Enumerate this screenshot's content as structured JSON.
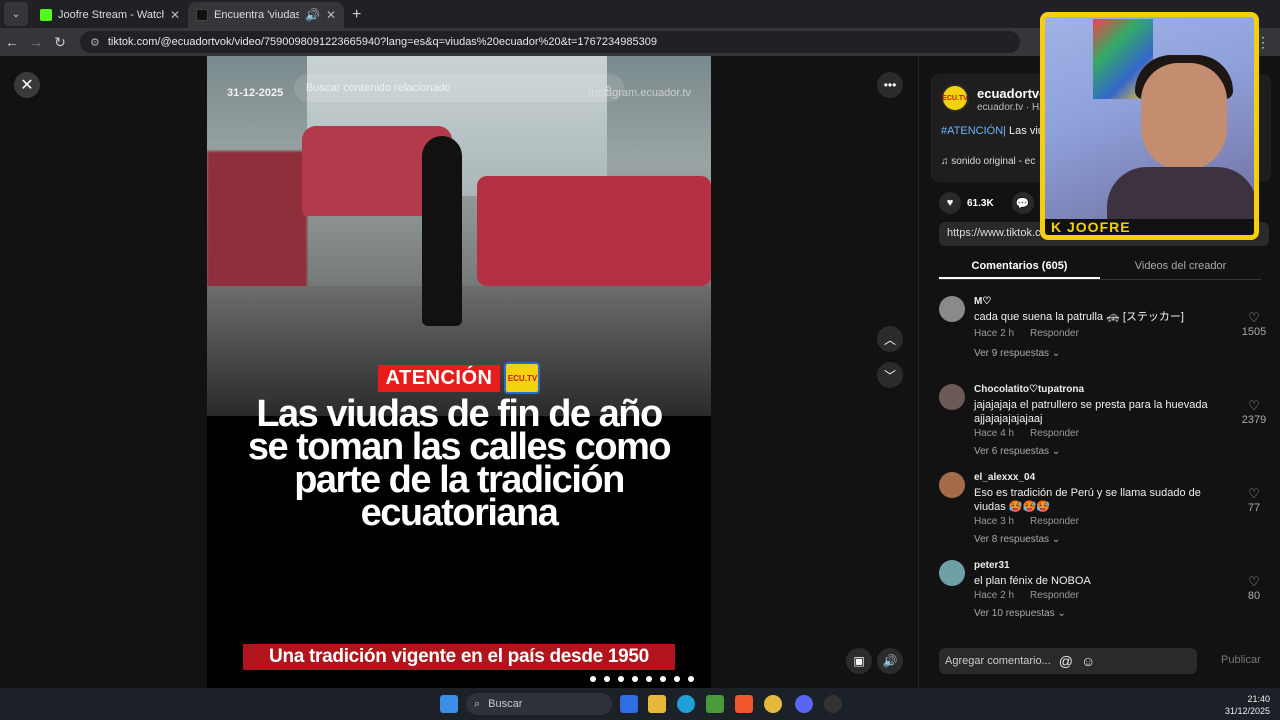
{
  "browser": {
    "tabs": [
      {
        "title": "Joofre Stream - Watch Live on Kick",
        "active": false,
        "favicon_color": "#53fc18"
      },
      {
        "title": "Encuentra 'viudas ecuador' en TikTok",
        "active": true,
        "favicon_color": "#000000"
      }
    ],
    "url": "tiktok.com/@ecuadortvok/video/7590098091223665940?lang=es&q=viudas%20ecuador%20&t=1767234985309"
  },
  "video": {
    "search_placeholder": "Buscar contenido relacionado",
    "date_stamp": "31-12-2025",
    "watermark": "instagram.ecuador.tv",
    "atencion_label": "ATENCIÓN",
    "logo_text": "ECU.TV",
    "headline": "Las viudas de fin de año se toman las calles como parte de la tradición ecuatoriana",
    "subline": "Una tradición vigente en el país desde 1950"
  },
  "panel": {
    "channel_name": "ecuadortvok",
    "channel_sub": "ecuador.tv · Ha",
    "description_tag": "#ATENCIÓN|",
    "description_text": " Las viudas... parte de la tradición",
    "sound": "sonido original - ec",
    "likes": "61.3K",
    "comments_count": "605",
    "link": "https://www.tiktok.com/",
    "tab_comments": "Comentarios (605)",
    "tab_creator": "Videos del creador",
    "comment_placeholder": "Agregar comentario...",
    "publish_label": "Publicar"
  },
  "comments": [
    {
      "user": "M♡",
      "text": "cada que suena la patrulla 🚓 [ステッカー]",
      "time": "Hace 2 h",
      "reply": "Responder",
      "more": "Ver 9 respuestas ⌄",
      "likes": "1505",
      "avatar_color": "#8a8a8a"
    },
    {
      "user": "Chocolatito♡tupatrona",
      "text": "jajajajaja el patrullero se presta para la huevada ajjajajajajajaaj",
      "time": "Hace 4 h",
      "reply": "Responder",
      "more": "Ver 6 respuestas ⌄",
      "likes": "2379",
      "avatar_color": "#6b5a55"
    },
    {
      "user": "el_alexxx_04",
      "text": "Eso es tradición de Perú y se llama sudado de viudas 🥵🥵🥵",
      "time": "Hace 3 h",
      "reply": "Responder",
      "more": "Ver 8 respuestas ⌄",
      "likes": "77",
      "avatar_color": "#a36b4a"
    },
    {
      "user": "peter31",
      "text": "el plan fénix de NOBOA",
      "time": "Hace 2 h",
      "reply": "Responder",
      "more": "Ver 10 respuestas ⌄",
      "likes": "80",
      "avatar_color": "#6fa0a8"
    }
  ],
  "streamer": {
    "label": "K JOOFRE",
    "frame_color": "#f5d00a"
  },
  "taskbar": {
    "search": "Buscar",
    "time": "21:40",
    "date": "31/12/2025"
  }
}
